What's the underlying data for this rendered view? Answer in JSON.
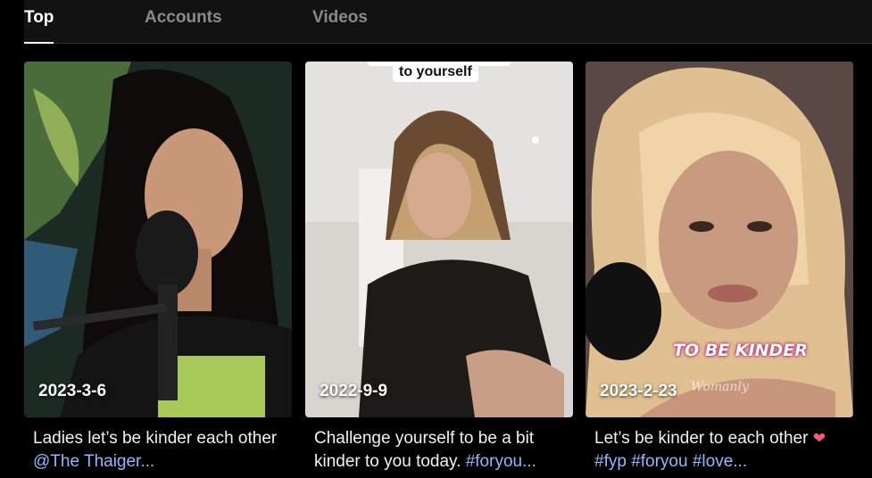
{
  "tabs": [
    {
      "label": "Top",
      "active": true
    },
    {
      "label": "Accounts",
      "active": false
    },
    {
      "label": "Videos",
      "active": false
    }
  ],
  "cards": [
    {
      "date": "2023-3-6",
      "caption_text": "Ladies let’s be kinder each other",
      "caption_tag": "@The Thaiger...",
      "thumbnail_subject": "woman speaking into podcast microphone"
    },
    {
      "date": "2022-9-9",
      "overlay_text": "to yourself",
      "caption_text": "Challenge yourself to be a bit kinder to you today.",
      "caption_tag": "#foryou...",
      "thumbnail_subject": "woman in dark sweater"
    },
    {
      "date": "2023-2-23",
      "overlay_text": "TO BE KINDER",
      "watermark": "Womanly",
      "caption_text": "Let’s be kinder to each other",
      "caption_icon": "heart-icon",
      "caption_tags": "#fyp #foryou #love...",
      "thumbnail_subject": "blonde woman with microphone"
    }
  ],
  "colors": {
    "background": "#000000",
    "tabbar": "#121212",
    "active_tab": "#ffffff",
    "inactive_tab": "#8a8a8a",
    "hashtag": "#8fb8ff"
  }
}
